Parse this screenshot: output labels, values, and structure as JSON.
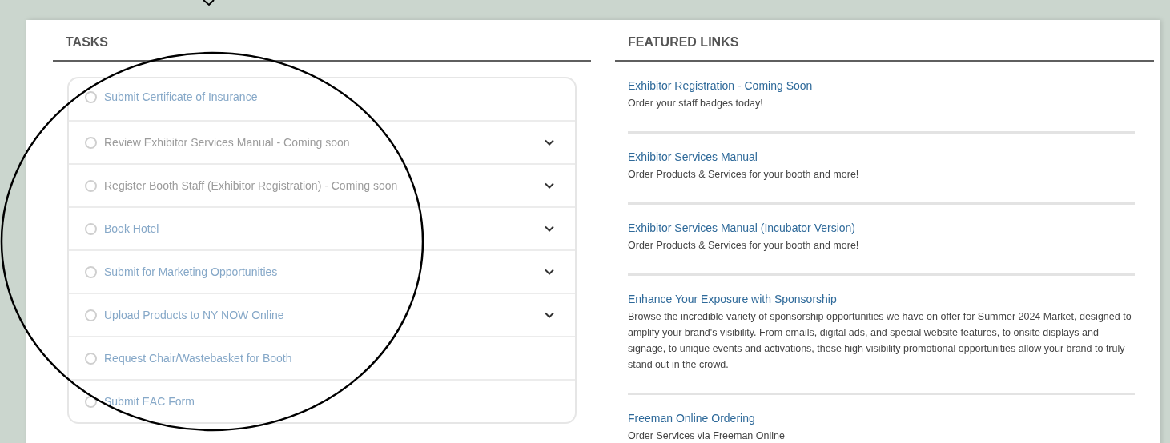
{
  "tasks": {
    "title": "TASKS",
    "items": [
      {
        "label": "Submit Certificate of Insurance",
        "disabled": false,
        "expandable": false
      },
      {
        "label": "Review Exhibitor Services Manual - Coming soon",
        "disabled": true,
        "expandable": true
      },
      {
        "label": "Register Booth Staff (Exhibitor Registration) - Coming soon",
        "disabled": true,
        "expandable": true
      },
      {
        "label": "Book Hotel",
        "disabled": false,
        "expandable": true
      },
      {
        "label": "Submit for Marketing Opportunities",
        "disabled": false,
        "expandable": true
      },
      {
        "label": "Upload Products to NY NOW Online",
        "disabled": false,
        "expandable": true
      },
      {
        "label": "Request Chair/Wastebasket for Booth",
        "disabled": false,
        "expandable": false
      },
      {
        "label": "Submit EAC Form",
        "disabled": false,
        "expandable": false
      }
    ]
  },
  "featured_links": {
    "title": "FEATURED LINKS",
    "items": [
      {
        "title": "Exhibitor Registration - Coming Soon",
        "description": "Order your staff badges today!"
      },
      {
        "title": "Exhibitor Services Manual",
        "description": "Order Products & Services for your booth and more!"
      },
      {
        "title": "Exhibitor Services Manual (Incubator Version)",
        "description": "Order Products & Services for your booth and more!"
      },
      {
        "title": "Enhance Your Exposure with Sponsorship",
        "description": "Browse the incredible variety of sponsorship opportunities we have on offer for Summer 2024 Market, designed to amplify your brand's visibility. From emails, digital ads, and special website features, to onsite displays and signage, to unique events and activations, these high visibility promotional opportunities allow your brand to truly stand out in the crowd."
      },
      {
        "title": "Freeman Online Ordering",
        "description": "Order Services via Freeman Online"
      }
    ]
  }
}
